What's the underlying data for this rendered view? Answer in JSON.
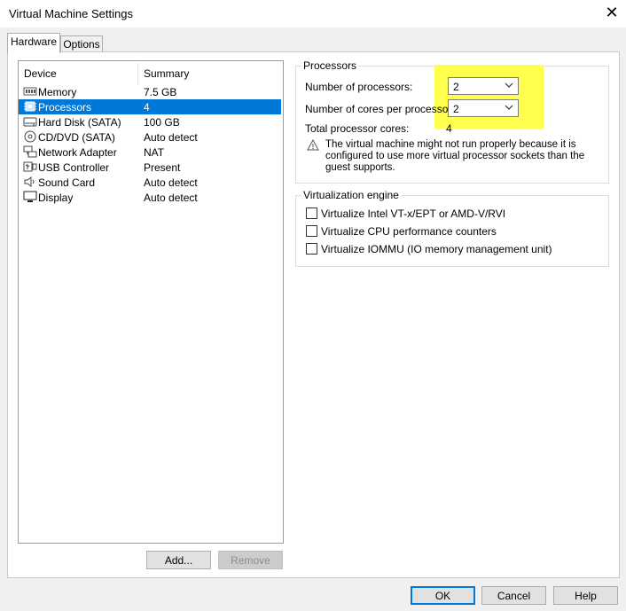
{
  "window": {
    "title": "Virtual Machine Settings",
    "close_glyph": "✕"
  },
  "tabs": [
    {
      "label": "Hardware",
      "active": true
    },
    {
      "label": "Options",
      "active": false
    }
  ],
  "devices": {
    "col_device": "Device",
    "col_summary": "Summary",
    "items": [
      {
        "name": "Memory",
        "summary": "7.5 GB",
        "icon": "memory-icon"
      },
      {
        "name": "Processors",
        "summary": "4",
        "icon": "processor-icon",
        "selected": true
      },
      {
        "name": "Hard Disk (SATA)",
        "summary": "100 GB",
        "icon": "hard-disk-icon"
      },
      {
        "name": "CD/DVD (SATA)",
        "summary": "Auto detect",
        "icon": "cd-dvd-icon"
      },
      {
        "name": "Network Adapter",
        "summary": "NAT",
        "icon": "network-adapter-icon"
      },
      {
        "name": "USB Controller",
        "summary": "Present",
        "icon": "usb-icon"
      },
      {
        "name": "Sound Card",
        "summary": "Auto detect",
        "icon": "speaker-icon"
      },
      {
        "name": "Display",
        "summary": "Auto detect",
        "icon": "monitor-icon"
      }
    ],
    "add_label": "Add...",
    "remove_label": "Remove"
  },
  "processors": {
    "group_title": "Processors",
    "num_processors_label": "Number of processors:",
    "num_processors_value": "2",
    "cores_label": "Number of cores per processor:",
    "cores_value": "2",
    "total_label": "Total processor cores:",
    "total_value": "4",
    "warning_text": "The virtual machine might not run properly because it is configured to use more virtual processor sockets than the guest supports."
  },
  "virtualization": {
    "group_title": "Virtualization engine",
    "options": [
      {
        "label": "Virtualize Intel VT-x/EPT or AMD-V/RVI",
        "checked": false
      },
      {
        "label": "Virtualize CPU performance counters",
        "checked": false
      },
      {
        "label": "Virtualize IOMMU (IO memory management unit)",
        "checked": false
      }
    ]
  },
  "footer": {
    "ok_label": "OK",
    "cancel_label": "Cancel",
    "help_label": "Help"
  },
  "colors": {
    "accent": "#0078d7",
    "highlight": "#ffff4d"
  }
}
